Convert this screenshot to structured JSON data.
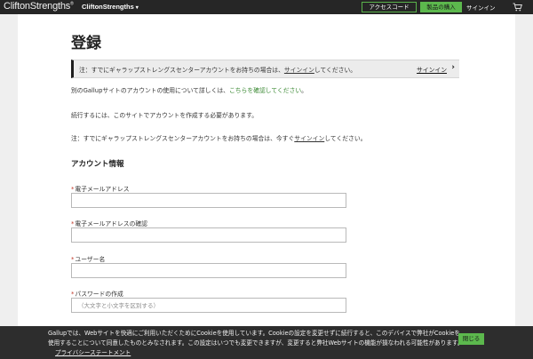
{
  "nav": {
    "logo": "CliftonStrengths",
    "logo_mark": "®",
    "product_menu": "CliftonStrengths",
    "access_code": "アクセスコード",
    "buy": "製品の購入",
    "signin": "サインイン",
    "cart_icon": "cart-icon"
  },
  "page": {
    "title": "登録",
    "notice": {
      "text_before": "注：すでにギャラップストレングスセンターアカウントをお持ちの場合は、",
      "text_link": "サインイン",
      "text_after": "してください。",
      "signin": "サインイン",
      "chevron": "›"
    },
    "gallup_note": {
      "before": "別のGallupサイトのアカウントの使用について詳しくは、",
      "link": "こちらを確認してください",
      "after": "。"
    },
    "continue_text": "続行するには、このサイトでアカウントを作成する必要があります。",
    "note2": {
      "before": "注：すでにギャラップストレングスセンターアカウントをお持ちの場合は、今すぐ",
      "link": "サインイン",
      "after": "してください。"
    },
    "section_title": "アカウント情報",
    "required_mark": "*",
    "fields": [
      {
        "label": "電子メールアドレス",
        "value": "",
        "placeholder": ""
      },
      {
        "label": "電子メールアドレスの確認",
        "value": "",
        "placeholder": ""
      },
      {
        "label": "ユーザー名",
        "value": "",
        "placeholder": ""
      },
      {
        "label": "パスワードの作成",
        "value": "",
        "placeholder": "（大文字と小文字を区別する）"
      }
    ]
  },
  "cookie": {
    "text": "Gallupでは、Webサイトを快適にご利用いただくためにCookieを使用しています。Cookieの設定を変更せずに続行すると、このデバイスで弊社がCookieを使用することについて同意したものとみなされます。この設定はいつでも変更できますが、変更すると弊社Webサイトの機能が損なわれる可能性があります。",
    "privacy_link": "プライバシーステートメント",
    "close": "閉じる"
  },
  "colors": {
    "nav_bg": "#262626",
    "accent_green": "#5cb84d",
    "link_green": "#3c8a35",
    "cookie_bg": "#2d2d2d"
  }
}
